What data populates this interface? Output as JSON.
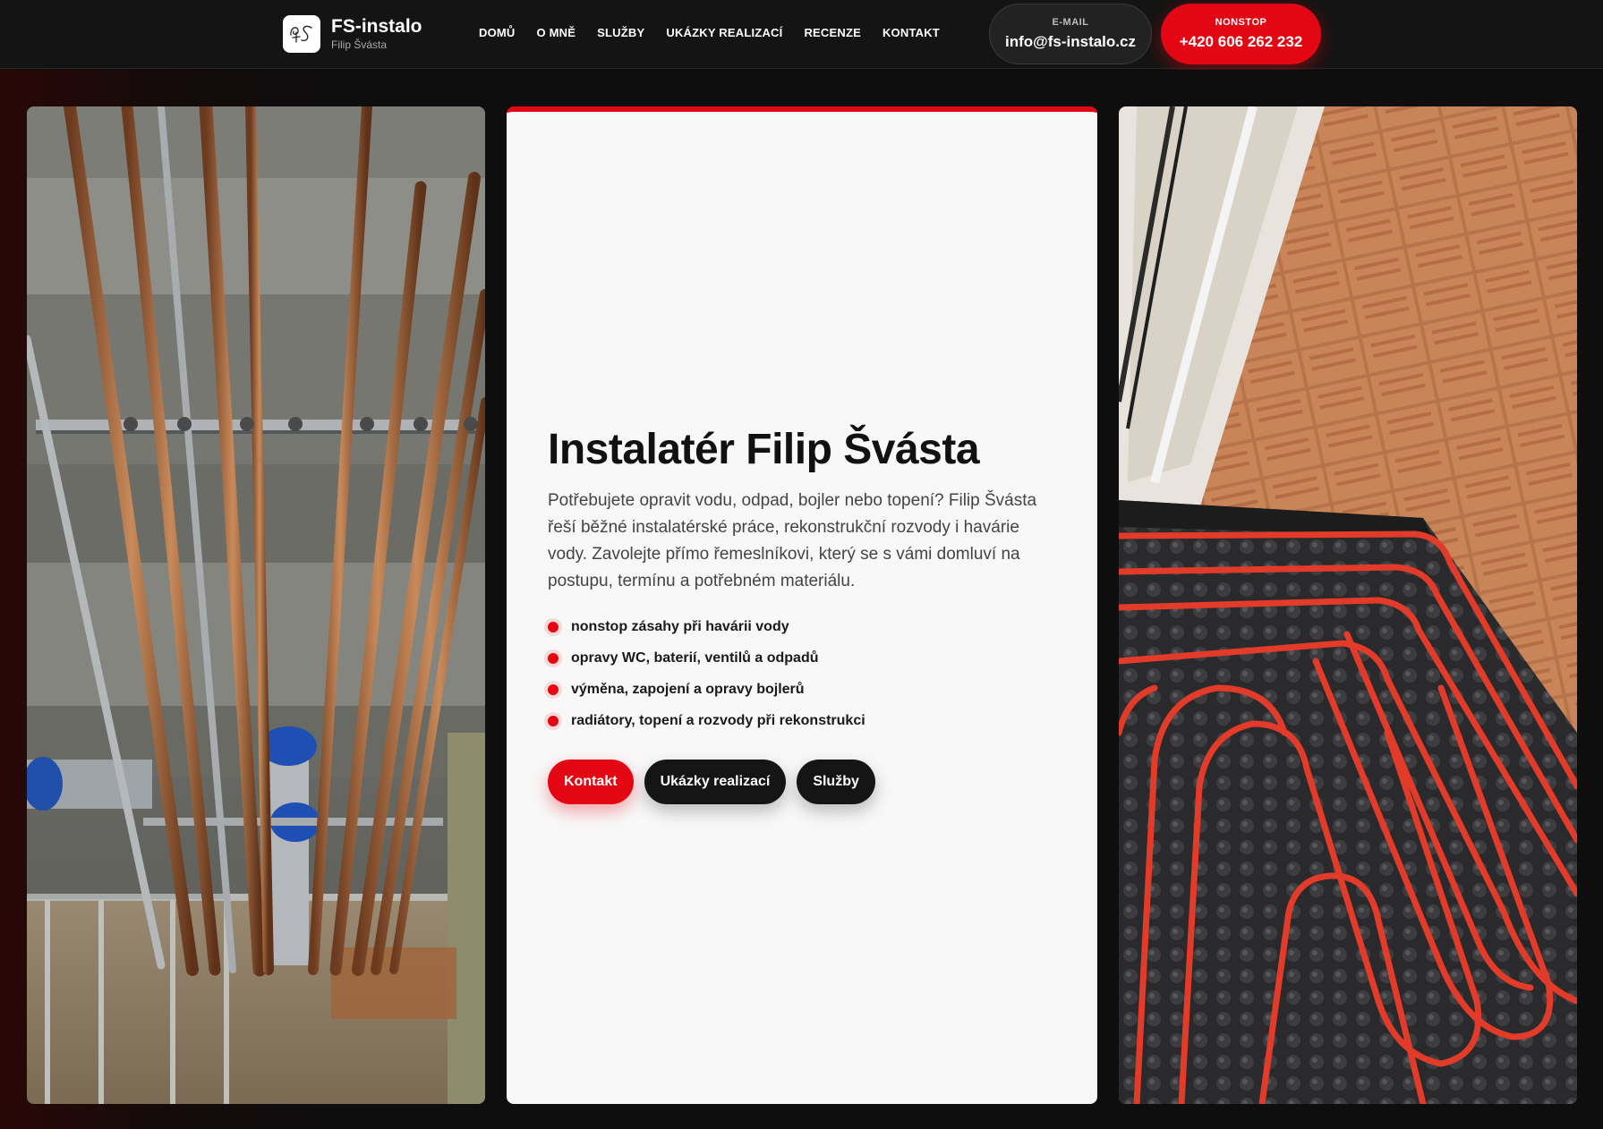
{
  "brand": {
    "name": "FS-instalo",
    "subtitle": "Filip Švásta",
    "logo_icon": "fs-monogram-icon"
  },
  "nav": {
    "items": [
      {
        "label": "DOMŮ"
      },
      {
        "label": "O MNĚ"
      },
      {
        "label": "SLUŽBY"
      },
      {
        "label": "UKÁZKY REALIZACÍ"
      },
      {
        "label": "RECENZE"
      },
      {
        "label": "KONTAKT"
      }
    ]
  },
  "contact": {
    "email_caption": "E-MAIL",
    "email": "info@fs-instalo.cz",
    "phone_caption": "NONSTOP",
    "phone": "+420 606 262 232"
  },
  "hero": {
    "title": "Instalatér Filip Švásta",
    "text": "Potřebujete opravit vodu, odpad, bojler nebo topení? Filip Švásta řeší běžné instalatérské práce, rekonstrukční rozvody i havárie vody. Zavolejte přímo řemeslníkovi, který se s vámi domluví na postupu, termínu a potřebném materiálu.",
    "bullets": [
      "nonstop zásahy při havárii vody",
      "opravy WC, baterií, ventilů a odpadů",
      "výměna, zapojení a opravy bojlerů",
      "radiátory, topení a rozvody při rekonstrukci"
    ],
    "buttons": {
      "contact": "Kontakt",
      "projects": "Ukázky realizací",
      "services": "Služby"
    }
  },
  "colors": {
    "accent": "#e30613",
    "header_bg": "#141414",
    "page_bg": "#0e0e0f",
    "card_bg": "#f8f8f8"
  }
}
